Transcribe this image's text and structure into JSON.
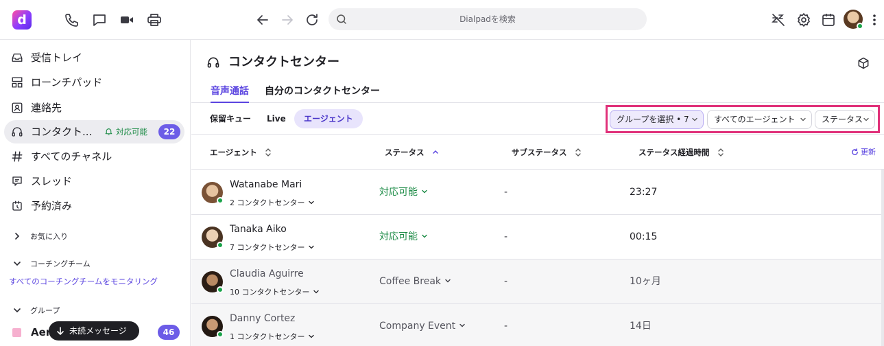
{
  "topbar": {
    "logo_letter": "d",
    "search_placeholder": "Dialpadを検索"
  },
  "sidebar": {
    "items": [
      {
        "label": "受信トレイ",
        "icon": "inbox-icon"
      },
      {
        "label": "ローンチパッド",
        "icon": "launchpad-icon"
      },
      {
        "label": "連絡先",
        "icon": "contacts-icon"
      },
      {
        "label": "コンタクト...",
        "icon": "headset-icon",
        "status": "対応可能",
        "badge": "22"
      },
      {
        "label": "すべてのチャネル",
        "icon": "hash-icon"
      },
      {
        "label": "スレッド",
        "icon": "thread-icon"
      },
      {
        "label": "予約済み",
        "icon": "clock-icon"
      }
    ],
    "sections": {
      "favorites": "お気に入り",
      "coaching": "コーチングチーム",
      "groups": "グループ"
    },
    "monitor_link": "すべてのコーチングチームをモニタリング",
    "group_item": {
      "label": "Aer",
      "badge": "46"
    },
    "unread_button": "未読メッセージ"
  },
  "main": {
    "title": "コンタクトセンター",
    "tabs": [
      {
        "label": "音声通話",
        "active": true
      },
      {
        "label": "自分のコンタクトセンター",
        "active": false
      }
    ],
    "subtabs": [
      {
        "label": "保留キュー",
        "active": false
      },
      {
        "label": "Live",
        "active": false
      },
      {
        "label": "エージェント",
        "active": true
      }
    ],
    "filters": {
      "group": "グループを選択 • 7",
      "agents": "すべてのエージェント",
      "status": "ステータス"
    },
    "columns": {
      "agent": "エージェント",
      "status": "ステータス",
      "substatus": "サブステータス",
      "elapsed": "ステータス経過時間",
      "refresh": "更新"
    },
    "rows": [
      {
        "name": "Watanabe Mari",
        "centers": "2 コンタクトセンター",
        "status": "対応可能",
        "substatus": "-",
        "elapsed": "23:27",
        "available": true
      },
      {
        "name": "Tanaka Aiko",
        "centers": "7 コンタクトセンター",
        "status": "対応可能",
        "substatus": "-",
        "elapsed": "00:15",
        "available": true
      },
      {
        "name": "Claudia Aguirre",
        "centers": "10 コンタクトセンター",
        "status": "Coffee Break",
        "substatus": "-",
        "elapsed": "10ヶ月",
        "available": false
      },
      {
        "name": "Danny Cortez",
        "centers": "1 コンタクトセンター",
        "status": "Company Event",
        "substatus": "-",
        "elapsed": "14日",
        "available": false
      }
    ]
  },
  "colors": {
    "accent": "#5b45e0",
    "available": "#1a8a44",
    "highlight_border": "#e0317a",
    "badge": "#6c5ce7"
  }
}
